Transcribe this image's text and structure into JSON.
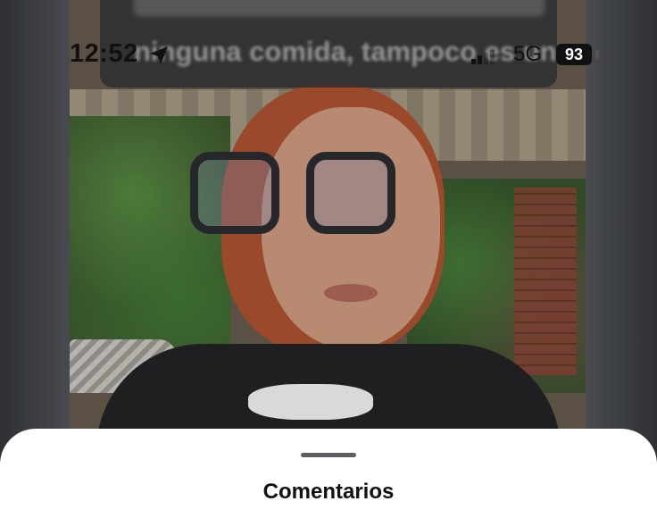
{
  "status_bar": {
    "time": "12:52",
    "network": "5G",
    "battery": "93"
  },
  "video": {
    "caption": "ninguna comida, tampoco es un"
  },
  "sheet": {
    "title": "Comentarios"
  },
  "icons": [
    "location-arrow-icon",
    "signal-icon"
  ]
}
